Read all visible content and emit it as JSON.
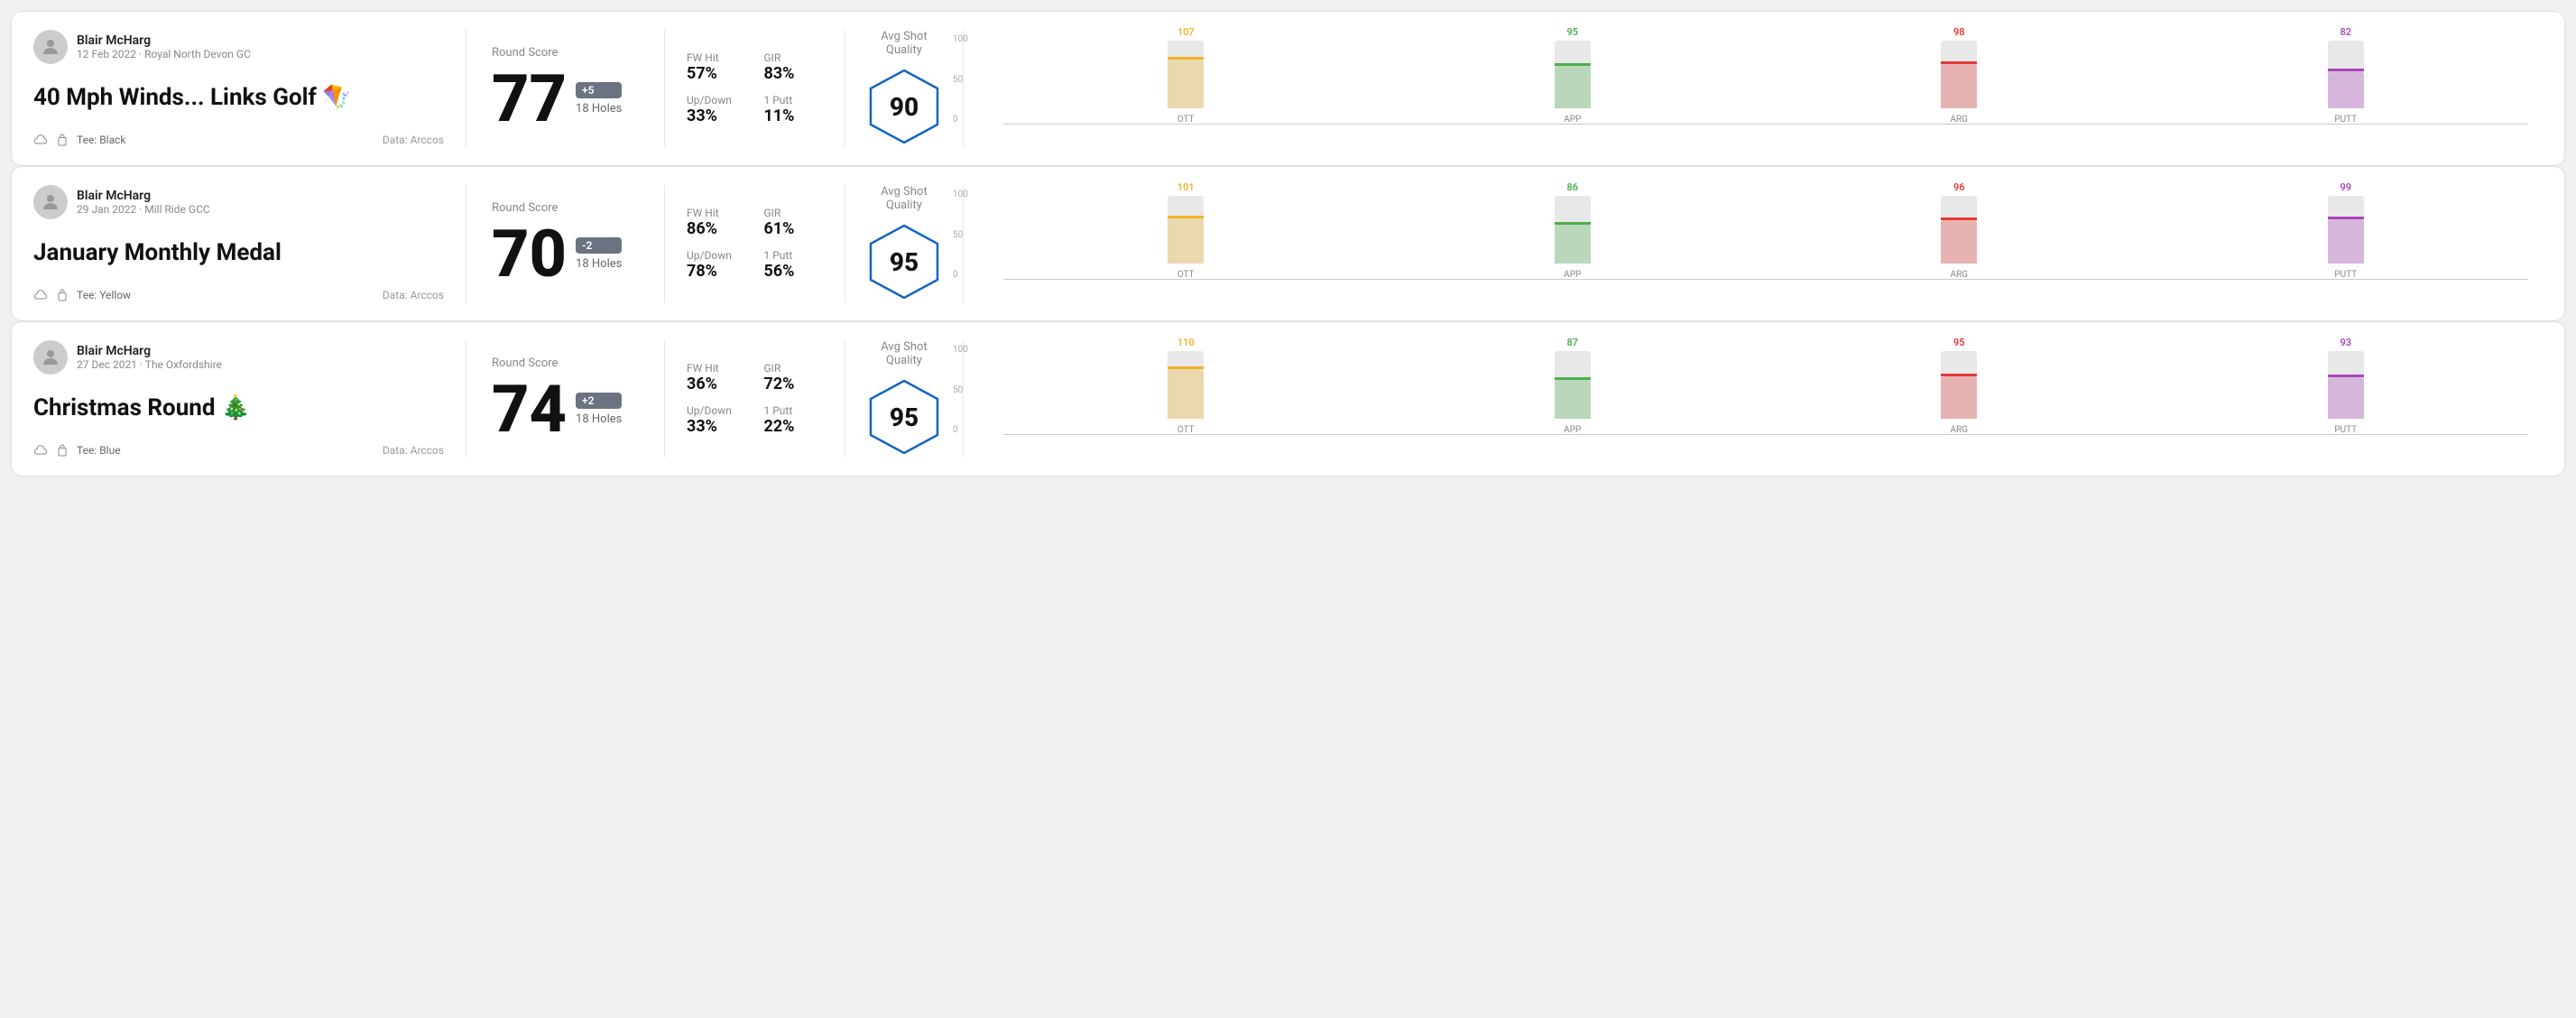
{
  "rounds": [
    {
      "id": "round1",
      "user": {
        "name": "Blair McHarg",
        "meta": "12 Feb 2022 · Royal North Devon GC"
      },
      "title": "40 Mph Winds... Links Golf 🪁",
      "tee": "Tee: Black",
      "data_source": "Data: Arccos",
      "round_score_label": "Round Score",
      "score": "77",
      "score_badge": "+5",
      "badge_type": "pos",
      "holes": "18 Holes",
      "stats": [
        {
          "label": "FW Hit",
          "value": "57%"
        },
        {
          "label": "GIR",
          "value": "83%"
        },
        {
          "label": "Up/Down",
          "value": "33%"
        },
        {
          "label": "1 Putt",
          "value": "11%"
        }
      ],
      "avg_shot_quality_label": "Avg Shot Quality",
      "quality_score": "90",
      "bars": [
        {
          "label": "OTT",
          "value": 107,
          "color": "#f0b429",
          "pct": 72
        },
        {
          "label": "APP",
          "value": 95,
          "color": "#4caf50",
          "pct": 63
        },
        {
          "label": "ARG",
          "value": 98,
          "color": "#e53935",
          "pct": 65
        },
        {
          "label": "PUTT",
          "value": 82,
          "color": "#ab47bc",
          "pct": 55
        }
      ],
      "chart_y": [
        "100",
        "50",
        "0"
      ]
    },
    {
      "id": "round2",
      "user": {
        "name": "Blair McHarg",
        "meta": "29 Jan 2022 · Mill Ride GCC"
      },
      "title": "January Monthly Medal",
      "tee": "Tee: Yellow",
      "data_source": "Data: Arccos",
      "round_score_label": "Round Score",
      "score": "70",
      "score_badge": "-2",
      "badge_type": "neg",
      "holes": "18 Holes",
      "stats": [
        {
          "label": "FW Hit",
          "value": "86%"
        },
        {
          "label": "GIR",
          "value": "61%"
        },
        {
          "label": "Up/Down",
          "value": "78%"
        },
        {
          "label": "1 Putt",
          "value": "56%"
        }
      ],
      "avg_shot_quality_label": "Avg Shot Quality",
      "quality_score": "95",
      "bars": [
        {
          "label": "OTT",
          "value": 101,
          "color": "#f0b429",
          "pct": 67
        },
        {
          "label": "APP",
          "value": 86,
          "color": "#4caf50",
          "pct": 57
        },
        {
          "label": "ARG",
          "value": 96,
          "color": "#e53935",
          "pct": 64
        },
        {
          "label": "PUTT",
          "value": 99,
          "color": "#ab47bc",
          "pct": 66
        }
      ],
      "chart_y": [
        "100",
        "50",
        "0"
      ]
    },
    {
      "id": "round3",
      "user": {
        "name": "Blair McHarg",
        "meta": "27 Dec 2021 · The Oxfordshire"
      },
      "title": "Christmas Round 🎄",
      "tee": "Tee: Blue",
      "data_source": "Data: Arccos",
      "round_score_label": "Round Score",
      "score": "74",
      "score_badge": "+2",
      "badge_type": "pos",
      "holes": "18 Holes",
      "stats": [
        {
          "label": "FW Hit",
          "value": "36%"
        },
        {
          "label": "GIR",
          "value": "72%"
        },
        {
          "label": "Up/Down",
          "value": "33%"
        },
        {
          "label": "1 Putt",
          "value": "22%"
        }
      ],
      "avg_shot_quality_label": "Avg Shot Quality",
      "quality_score": "95",
      "bars": [
        {
          "label": "OTT",
          "value": 110,
          "color": "#f0b429",
          "pct": 73
        },
        {
          "label": "APP",
          "value": 87,
          "color": "#4caf50",
          "pct": 58
        },
        {
          "label": "ARG",
          "value": 95,
          "color": "#e53935",
          "pct": 63
        },
        {
          "label": "PUTT",
          "value": 93,
          "color": "#ab47bc",
          "pct": 62
        }
      ],
      "chart_y": [
        "100",
        "50",
        "0"
      ]
    }
  ]
}
